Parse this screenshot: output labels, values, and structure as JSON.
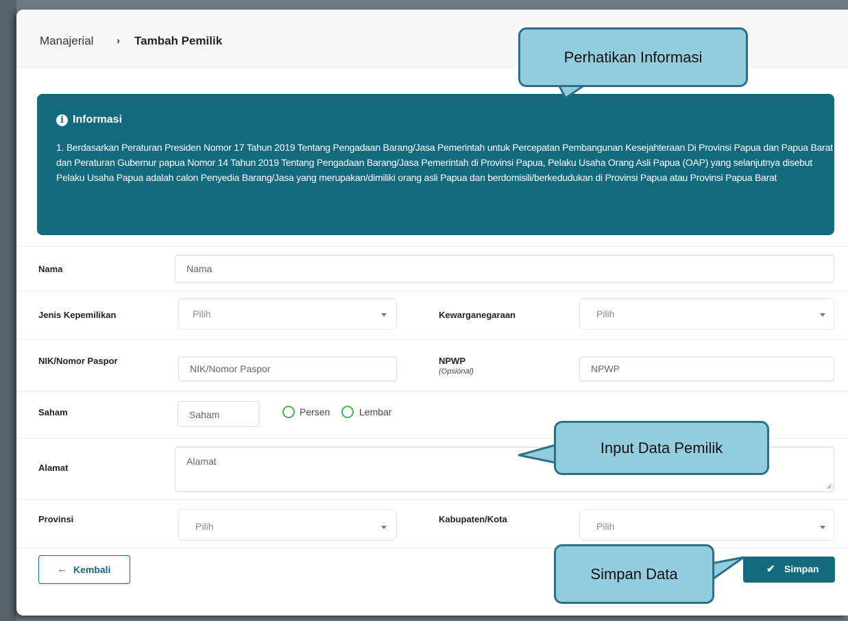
{
  "breadcrumb": {
    "parent": "Manajerial",
    "separator": "›",
    "current": "Tambah Pemilik"
  },
  "info": {
    "icon": "info-circle-icon",
    "title": "Informasi",
    "text": "1. Berdasarkan Peraturan Presiden Nomor 17 Tahun 2019 Tentang Pengadaan Barang/Jasa Pemerintah untuk Percepatan Pembangunan Kesejahteraan Di Provinsi Papua dan Papua Barat dan Peraturan Gubernur papua Nomor 14 Tahun 2019 Tentang Pengadaan Barang/Jasa Pemerintah di Provinsi Papua, Pelaku Usaha Orang Asli Papua (OAP) yang selanjutnya disebut Pelaku Usaha Papua adalah calon Penyedia Barang/Jasa yang merupakan/dimiliki orang asli Papua dan berdomisili/berkedudukan di Provinsi Papua atau Provinsi Papua Barat"
  },
  "form": {
    "nama": {
      "label": "Nama",
      "placeholder": "Nama"
    },
    "jenis": {
      "label": "Jenis Kepemilikan",
      "value": "Pilih"
    },
    "kewarganegaraan": {
      "label": "Kewarganegaraan",
      "value": "Pilih"
    },
    "nik": {
      "label": "NIK/Nomor Paspor",
      "placeholder": "NIK/Nomor Paspor"
    },
    "npwp": {
      "label": "NPWP",
      "sublabel": "(Opsional)",
      "placeholder": "NPWP"
    },
    "saham": {
      "label": "Saham",
      "placeholder": "Saham",
      "option1": "Persen",
      "option2": "Lembar"
    },
    "alamat": {
      "label": "Alamat",
      "placeholder": "Alamat"
    },
    "provinsi": {
      "label": "Provinsi",
      "value": "Pilih"
    },
    "kabupaten": {
      "label": "Kabupaten/Kota",
      "value": "Pilih"
    }
  },
  "buttons": {
    "back": "Kembali",
    "back_icon": "arrow-left-icon",
    "save": "Simpan",
    "save_icon": "check-icon"
  },
  "callouts": {
    "info": "Perhatikan Informasi",
    "input": "Input Data Pemilik",
    "save": "Simpan Data"
  },
  "colors": {
    "primary": "#136a7e",
    "callout_fill": "#93cddd",
    "callout_border": "#2b6f86",
    "radio": "#4caf50"
  }
}
